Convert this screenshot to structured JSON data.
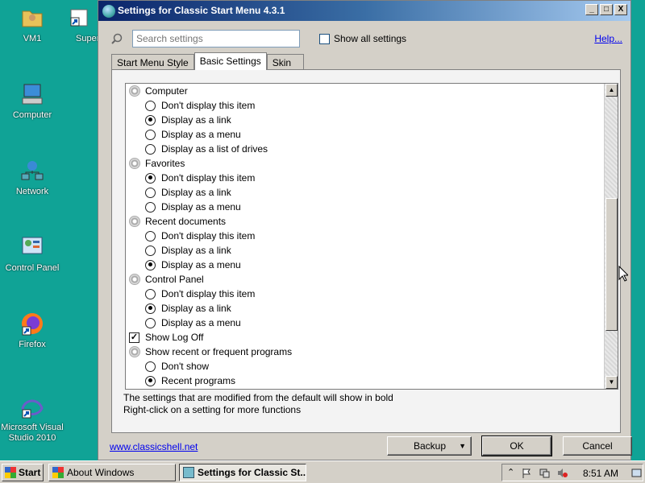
{
  "desktop": {
    "icons": [
      {
        "label": "VM1",
        "icon": "folder-user-icon"
      },
      {
        "label": "Super",
        "icon": "shortcut-icon"
      },
      {
        "label": "Computer",
        "icon": "computer-icon"
      },
      {
        "label": "Network",
        "icon": "network-icon"
      },
      {
        "label": "Control Panel",
        "icon": "control-panel-icon"
      },
      {
        "label": "Firefox",
        "icon": "firefox-icon"
      },
      {
        "label": "Microsoft Visual Studio 2010",
        "icon": "visual-studio-icon"
      }
    ]
  },
  "window": {
    "title": "Settings for Classic Start Menu 4.3.1",
    "controls": {
      "minimize": "_",
      "maximize": "□",
      "close": "X"
    }
  },
  "search": {
    "placeholder": "Search settings"
  },
  "show_all": {
    "label": "Show all settings",
    "checked": false
  },
  "help_link": "Help...",
  "tabs": [
    {
      "label": "Start Menu Style",
      "active": false
    },
    {
      "label": "Basic Settings",
      "active": true
    },
    {
      "label": "Skin",
      "active": false
    }
  ],
  "settings": [
    {
      "kind": "group",
      "label": "Computer"
    },
    {
      "kind": "radio",
      "label": "Don't display this item",
      "selected": false
    },
    {
      "kind": "radio",
      "label": "Display as a link",
      "selected": true
    },
    {
      "kind": "radio",
      "label": "Display as a menu",
      "selected": false
    },
    {
      "kind": "radio",
      "label": "Display as a list of drives",
      "selected": false
    },
    {
      "kind": "group",
      "label": "Favorites"
    },
    {
      "kind": "radio",
      "label": "Don't display this item",
      "selected": true
    },
    {
      "kind": "radio",
      "label": "Display as a link",
      "selected": false
    },
    {
      "kind": "radio",
      "label": "Display as a menu",
      "selected": false
    },
    {
      "kind": "group",
      "label": "Recent documents"
    },
    {
      "kind": "radio",
      "label": "Don't display this item",
      "selected": false
    },
    {
      "kind": "radio",
      "label": "Display as a link",
      "selected": false
    },
    {
      "kind": "radio",
      "label": "Display as a menu",
      "selected": true
    },
    {
      "kind": "group",
      "label": "Control Panel"
    },
    {
      "kind": "radio",
      "label": "Don't display this item",
      "selected": false
    },
    {
      "kind": "radio",
      "label": "Display as a link",
      "selected": true
    },
    {
      "kind": "radio",
      "label": "Display as a menu",
      "selected": false
    },
    {
      "kind": "check",
      "label": "Show Log Off",
      "checked": true
    },
    {
      "kind": "group",
      "label": "Show recent or frequent programs"
    },
    {
      "kind": "radio",
      "label": "Don't show",
      "selected": false
    },
    {
      "kind": "radio",
      "label": "Recent programs",
      "selected": true
    }
  ],
  "notes": {
    "line1": "The settings that are modified from the default will show in bold",
    "line2": "Right-click on a setting for more functions"
  },
  "footer": {
    "website": "www.classicshell.net",
    "backup_label": "Backup",
    "ok_label": "OK",
    "cancel_label": "Cancel"
  },
  "taskbar": {
    "start_label": "Start",
    "tasks": [
      {
        "label": "About Windows",
        "active": false
      },
      {
        "label": "Settings for Classic St...",
        "active": true
      }
    ],
    "clock": "8:51 AM"
  }
}
